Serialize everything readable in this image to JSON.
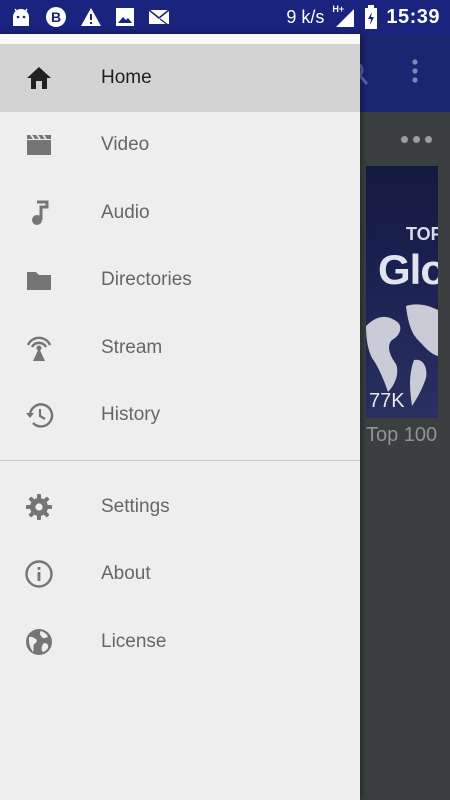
{
  "status_bar": {
    "speed": "9 k/s",
    "network": "H+",
    "time": "15:39"
  },
  "background": {
    "thumbnail": {
      "top_text": "TOP",
      "big_text": "Glo",
      "count": "77K"
    },
    "item_title": "Top 100"
  },
  "drawer": {
    "primary_items": [
      {
        "label": "Home",
        "icon": "home-icon",
        "active": true
      },
      {
        "label": "Video",
        "icon": "video-clapper-icon",
        "active": false
      },
      {
        "label": "Audio",
        "icon": "music-note-icon",
        "active": false
      },
      {
        "label": "Directories",
        "icon": "folder-icon",
        "active": false
      },
      {
        "label": "Stream",
        "icon": "broadcast-icon",
        "active": false
      },
      {
        "label": "History",
        "icon": "history-icon",
        "active": false
      }
    ],
    "secondary_items": [
      {
        "label": "Settings",
        "icon": "gear-icon"
      },
      {
        "label": "About",
        "icon": "info-icon"
      },
      {
        "label": "License",
        "icon": "globe-icon"
      }
    ]
  },
  "colors": {
    "status_bar": "#1a237e",
    "toolbar": "#1b2670",
    "drawer_bg": "#eeeeee",
    "active_item_bg": "#d3d3d3",
    "icon_color": "#757575",
    "active_icon_color": "#212121"
  }
}
